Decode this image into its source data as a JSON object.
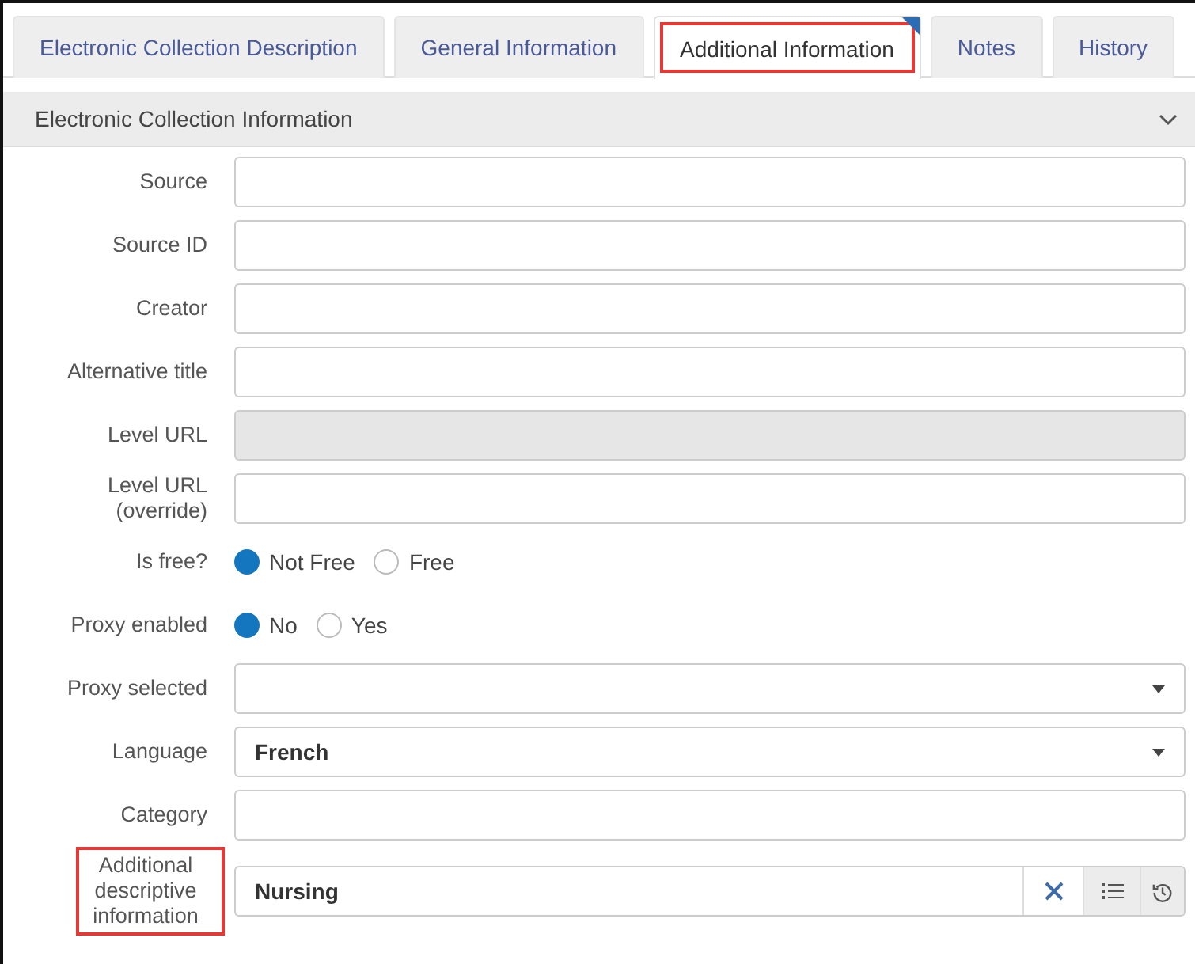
{
  "tabs": [
    {
      "label": "Electronic Collection Description",
      "selected": false,
      "highlighted": false
    },
    {
      "label": "General Information",
      "selected": false,
      "highlighted": false
    },
    {
      "label": "Additional Information",
      "selected": true,
      "highlighted": true
    },
    {
      "label": "Notes",
      "selected": false,
      "highlighted": false
    },
    {
      "label": "History",
      "selected": false,
      "highlighted": false
    }
  ],
  "section": {
    "title": "Electronic Collection Information",
    "expanded": true
  },
  "fields": [
    {
      "kind": "text",
      "label": "Source",
      "disabled": false
    },
    {
      "kind": "text",
      "label": "Source ID",
      "disabled": false
    },
    {
      "kind": "text",
      "label": "Creator",
      "disabled": false
    },
    {
      "kind": "text",
      "label": "Alternative title",
      "disabled": false
    },
    {
      "kind": "text",
      "label": "Level URL",
      "disabled": true
    },
    {
      "kind": "text",
      "label": "Level URL (override)",
      "disabled": false
    },
    {
      "kind": "radio",
      "label": "Is free?",
      "options": [
        {
          "label": "Not Free",
          "selected": true
        },
        {
          "label": "Free",
          "selected": false
        }
      ]
    },
    {
      "kind": "radio",
      "label": "Proxy enabled",
      "options": [
        {
          "label": "No",
          "selected": true
        },
        {
          "label": "Yes",
          "selected": false
        }
      ]
    },
    {
      "kind": "select",
      "label": "Proxy selected"
    },
    {
      "kind": "select",
      "label": "Language",
      "value": "French"
    },
    {
      "kind": "text",
      "label": "Category",
      "disabled": false
    },
    {
      "kind": "multi",
      "label": "Additional descriptive information",
      "value": "Nursing",
      "highlighted": true
    }
  ]
}
